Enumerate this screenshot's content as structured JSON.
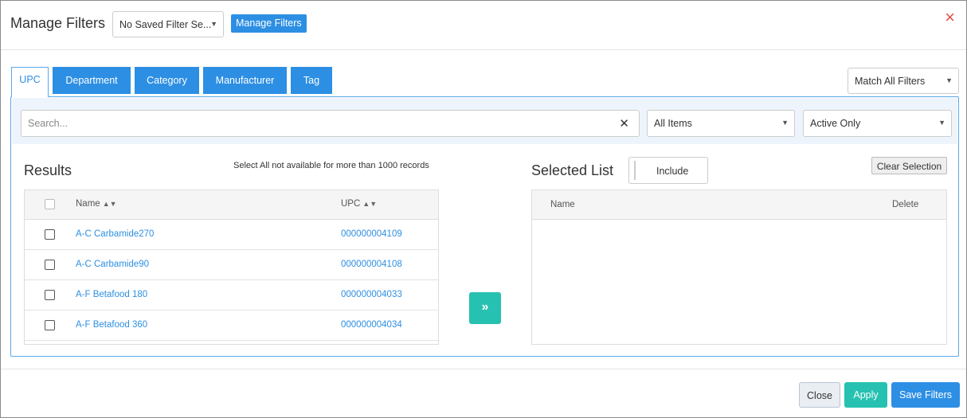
{
  "header": {
    "title": "Manage Filters",
    "saved_filter_value": "No Saved Filter Se...",
    "manage_button": "Manage Filters",
    "close_icon": "×"
  },
  "tabs": [
    {
      "label": "UPC",
      "active": true
    },
    {
      "label": "Department",
      "active": false
    },
    {
      "label": "Category",
      "active": false
    },
    {
      "label": "Manufacturer",
      "active": false
    },
    {
      "label": "Tag",
      "active": false
    }
  ],
  "match_select": "Match All Filters",
  "filters": {
    "search_placeholder": "Search...",
    "items_select": "All Items",
    "status_select": "Active Only"
  },
  "results": {
    "title": "Results",
    "note": "Select All not available for more than 1000 records",
    "columns": [
      "Name",
      "UPC"
    ],
    "rows": [
      {
        "name": "A-C Carbamide270",
        "upc": "000000004109"
      },
      {
        "name": "A-C Carbamide90",
        "upc": "000000004108"
      },
      {
        "name": "A-F Betafood 180",
        "upc": "000000004033"
      },
      {
        "name": "A-F Betafood 360",
        "upc": "000000004034"
      }
    ]
  },
  "move_button_icon": "»",
  "selected": {
    "title": "Selected List",
    "toggle_label": "Include",
    "clear_button": "Clear Selection",
    "columns": [
      "Name",
      "Delete"
    ]
  },
  "footer": {
    "close": "Close",
    "apply": "Apply",
    "save": "Save Filters"
  },
  "colors": {
    "primary": "#2d8fe3",
    "teal": "#26c1b0",
    "close_red": "#e0504b"
  }
}
